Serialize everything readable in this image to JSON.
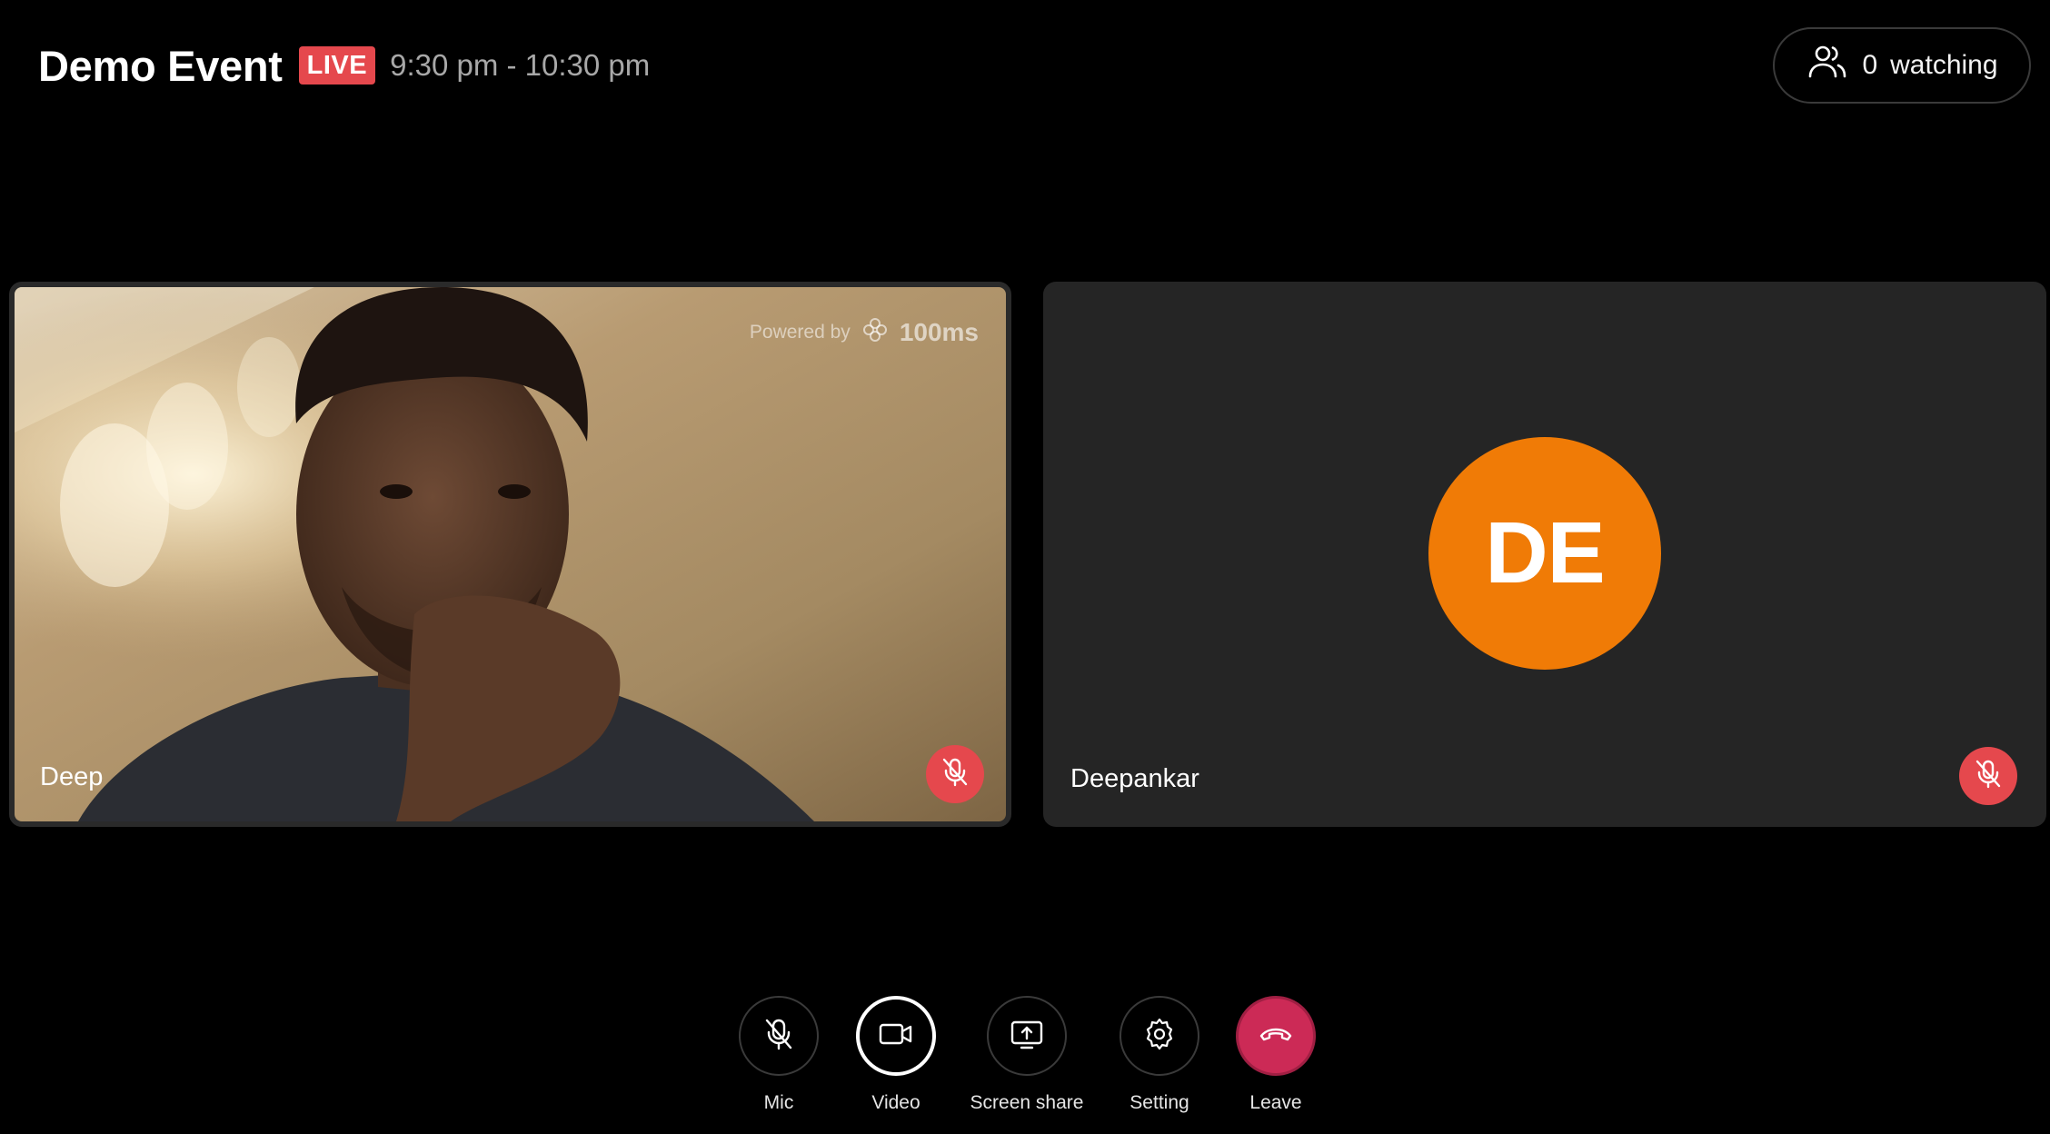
{
  "header": {
    "title": "Demo Event",
    "live_badge": "LIVE",
    "time_range": "9:30 pm - 10:30 pm",
    "watching_count": "0",
    "watching_label": "watching"
  },
  "tiles": [
    {
      "name": "Deep",
      "muted": true,
      "powered_by": "Powered by",
      "brand": "100ms"
    },
    {
      "name": "Deepankar",
      "initials": "DE",
      "avatar_color": "#f07b06",
      "muted": true
    }
  ],
  "controls": {
    "mic": "Mic",
    "video": "Video",
    "screen_share": "Screen share",
    "setting": "Setting",
    "leave": "Leave"
  },
  "colors": {
    "live": "#e5484d",
    "mute": "#e5484d",
    "leave": "#cc2a56",
    "avatar": "#f07b06"
  }
}
